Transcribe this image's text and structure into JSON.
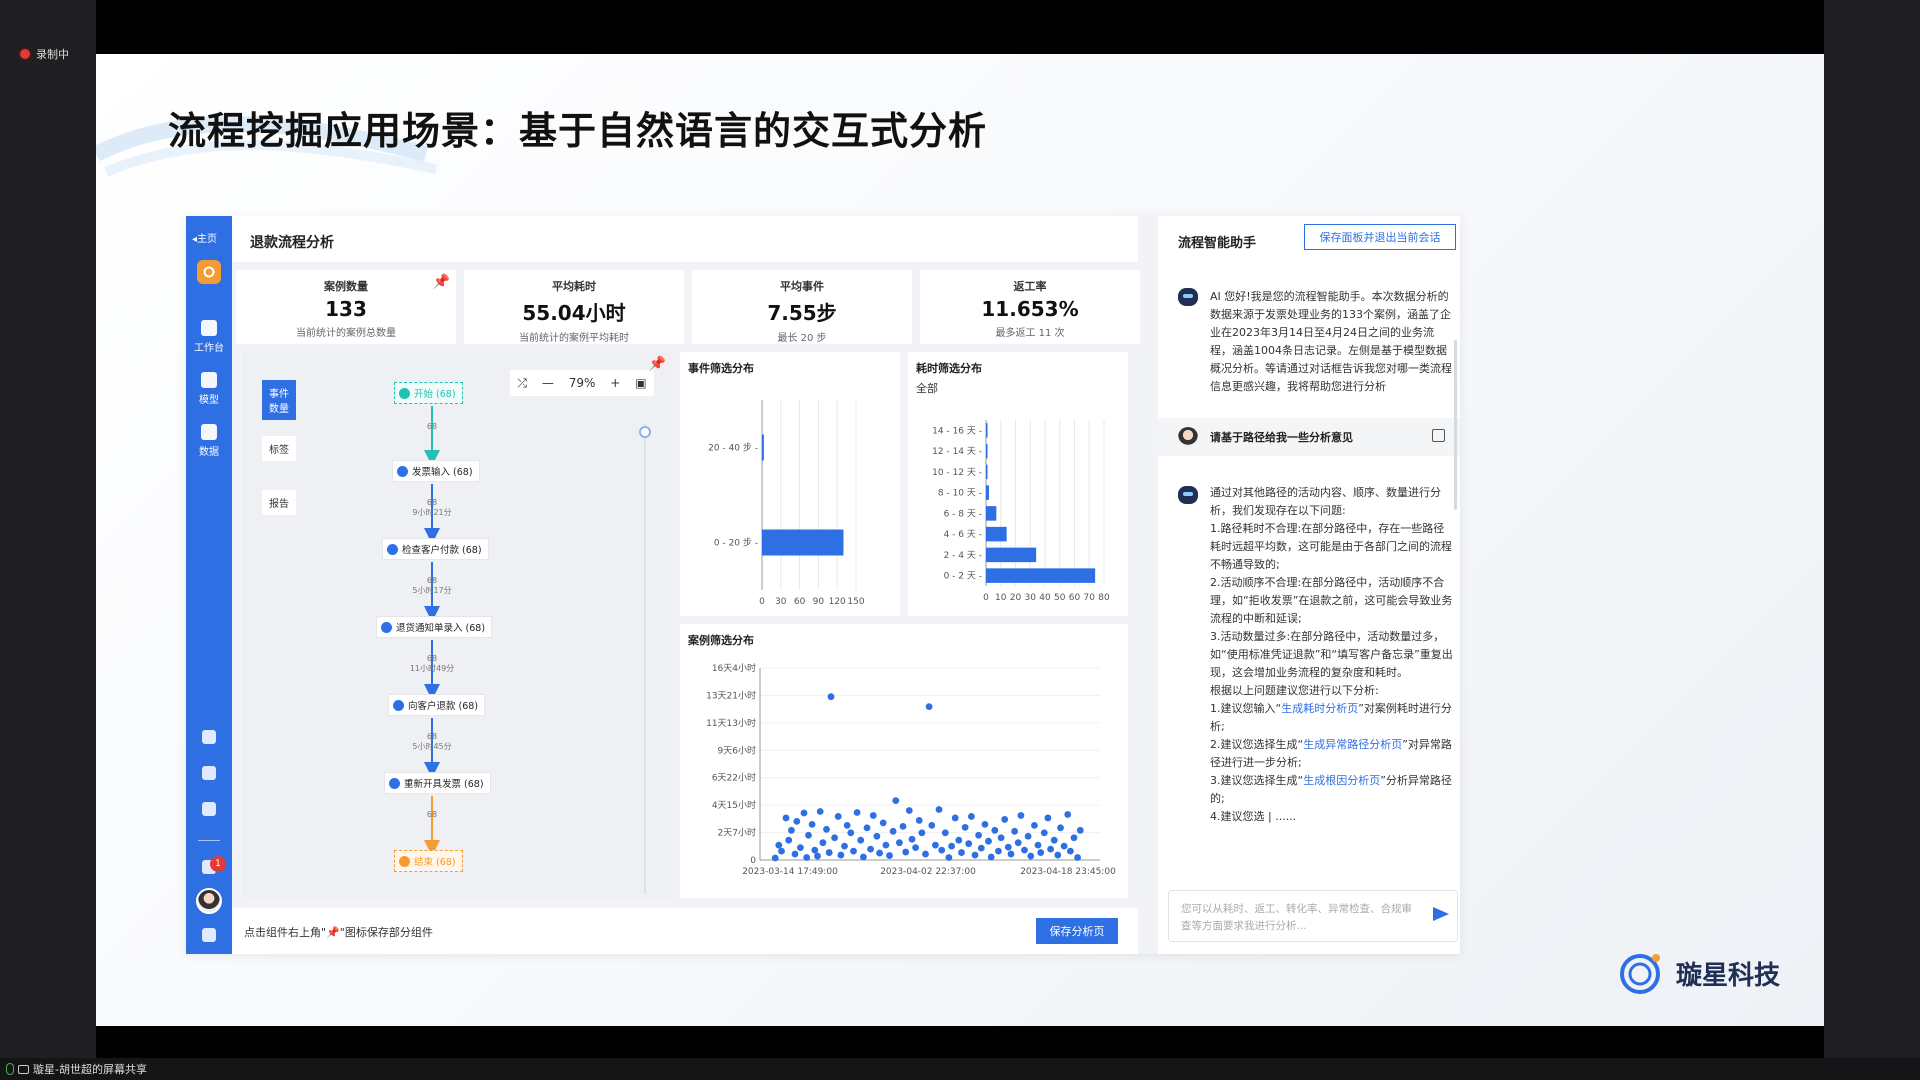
{
  "meeting": {
    "recording_label": "录制中",
    "share_label": "璇星-胡世超的屏幕共享"
  },
  "slide": {
    "title": "流程挖掘应用场景：基于自然语言的交互式分析",
    "brand": "璇星科技"
  },
  "app": {
    "nav": {
      "home": "◂主页",
      "items": [
        "工作台",
        "模型",
        "数据"
      ],
      "notification_count": "1"
    },
    "page_title": "退款流程分析",
    "kpis": [
      {
        "title": "案例数量",
        "value": "133",
        "sub": "当前统计的案例总数量"
      },
      {
        "title": "平均耗时",
        "value": "55.04小时",
        "sub": "当前统计的案例平均耗时"
      },
      {
        "title": "平均事件",
        "value": "7.55步",
        "sub": "最长 20 步"
      },
      {
        "title": "返工率",
        "value": "11.653%",
        "sub": "最多返工 11 次"
      }
    ],
    "process": {
      "tabs": [
        "事件\n数量",
        "标签",
        "报告"
      ],
      "zoom": "79%",
      "nodes": [
        "开始 (68)",
        "发票输入 (68)",
        "检查客户付款 (68)",
        "退货通知单录入 (68)",
        "向客户退款 (68)",
        "重新开具发票 (68)",
        "结束 (68)"
      ],
      "edges": [
        {
          "count": "68",
          "duration": ""
        },
        {
          "count": "68",
          "duration": "9小时21分"
        },
        {
          "count": "68",
          "duration": "5小时17分"
        },
        {
          "count": "68",
          "duration": "11小时49分"
        },
        {
          "count": "68",
          "duration": "5小时45分"
        },
        {
          "count": "68",
          "duration": ""
        }
      ]
    },
    "footer": {
      "hint": "点击组件右上角\"📌\"图标保存部分组件",
      "save_label": "保存分析页"
    }
  },
  "chart_data": [
    {
      "type": "bar",
      "orientation": "horizontal",
      "title": "事件筛选分布",
      "categories": [
        "0 - 20 步",
        "20 - 40 步"
      ],
      "values": [
        130,
        3
      ],
      "xticks": [
        "0",
        "30",
        "60",
        "90",
        "120",
        "150"
      ],
      "xlim": [
        0,
        150
      ],
      "color": "#2f6fe4"
    },
    {
      "type": "bar",
      "orientation": "horizontal",
      "title": "耗时筛选分布",
      "subtitle": "全部",
      "categories": [
        "0 - 2 天",
        "2 - 4 天",
        "4 - 6 天",
        "6 - 8 天",
        "8 - 10 天",
        "10 - 12 天",
        "12 - 14 天",
        "14 - 16 天"
      ],
      "values": [
        74,
        34,
        14,
        7,
        2,
        1,
        1,
        1
      ],
      "xticks": [
        "0",
        "10",
        "20",
        "30",
        "40",
        "50",
        "60",
        "70",
        "80"
      ],
      "xlim": [
        0,
        80
      ],
      "color": "#2f6fe4"
    },
    {
      "type": "scatter",
      "title": "案例筛选分布",
      "yticks": [
        "16天4小时",
        "13天21小时",
        "11天13小时",
        "9天6小时",
        "6天22小时",
        "4天15小时",
        "2天7小时",
        "0"
      ],
      "ylim_hours": [
        0,
        388
      ],
      "xticks": [
        "2023-03-14 17:49:00",
        "2023-04-02 22:37:00",
        "2023-04-18 23:45:00"
      ],
      "x_unit": "days since 2023-03-14",
      "xlim": [
        0,
        36
      ],
      "color": "#2f6fe4",
      "points": [
        [
          0.8,
          4
        ],
        [
          1.2,
          30
        ],
        [
          1.5,
          18
        ],
        [
          2.0,
          85
        ],
        [
          2.3,
          40
        ],
        [
          2.6,
          60
        ],
        [
          3.0,
          12
        ],
        [
          3.2,
          78
        ],
        [
          3.6,
          25
        ],
        [
          4.0,
          95
        ],
        [
          4.3,
          5
        ],
        [
          4.5,
          50
        ],
        [
          4.9,
          72
        ],
        [
          5.2,
          20
        ],
        [
          5.5,
          8
        ],
        [
          5.8,
          98
        ],
        [
          6.1,
          35
        ],
        [
          6.5,
          62
        ],
        [
          6.8,
          15
        ],
        [
          7.0,
          330
        ],
        [
          7.4,
          45
        ],
        [
          7.8,
          88
        ],
        [
          8.1,
          10
        ],
        [
          8.5,
          28
        ],
        [
          8.8,
          70
        ],
        [
          9.2,
          55
        ],
        [
          9.5,
          18
        ],
        [
          9.9,
          96
        ],
        [
          10.3,
          40
        ],
        [
          10.6,
          6
        ],
        [
          11.0,
          65
        ],
        [
          11.4,
          22
        ],
        [
          11.7,
          90
        ],
        [
          12.1,
          48
        ],
        [
          12.4,
          14
        ],
        [
          12.8,
          75
        ],
        [
          13.1,
          30
        ],
        [
          13.5,
          9
        ],
        [
          13.9,
          58
        ],
        [
          14.2,
          120
        ],
        [
          14.6,
          35
        ],
        [
          15.0,
          68
        ],
        [
          15.3,
          16
        ],
        [
          15.7,
          100
        ],
        [
          16.0,
          42
        ],
        [
          16.4,
          25
        ],
        [
          16.8,
          80
        ],
        [
          17.1,
          55
        ],
        [
          17.5,
          12
        ],
        [
          17.9,
          310
        ],
        [
          18.2,
          70
        ],
        [
          18.6,
          30
        ],
        [
          19.0,
          102
        ],
        [
          19.3,
          20
        ],
        [
          19.7,
          55
        ],
        [
          20.1,
          5
        ],
        [
          20.4,
          28
        ],
        [
          20.8,
          85
        ],
        [
          21.2,
          40
        ],
        [
          21.5,
          15
        ],
        [
          21.9,
          66
        ],
        [
          22.3,
          33
        ],
        [
          22.6,
          88
        ],
        [
          23.0,
          10
        ],
        [
          23.4,
          50
        ],
        [
          23.7,
          24
        ],
        [
          24.1,
          72
        ],
        [
          24.5,
          38
        ],
        [
          24.8,
          6
        ],
        [
          25.2,
          60
        ],
        [
          25.6,
          18
        ],
        [
          25.9,
          45
        ],
        [
          26.3,
          82
        ],
        [
          26.7,
          26
        ],
        [
          27.0,
          12
        ],
        [
          27.4,
          58
        ],
        [
          27.8,
          35
        ],
        [
          28.1,
          90
        ],
        [
          28.5,
          20
        ],
        [
          28.9,
          48
        ],
        [
          29.2,
          8
        ],
        [
          29.6,
          70
        ],
        [
          30.0,
          30
        ],
        [
          30.3,
          15
        ],
        [
          30.7,
          55
        ],
        [
          31.1,
          85
        ],
        [
          31.4,
          22
        ],
        [
          31.8,
          40
        ],
        [
          32.2,
          10
        ],
        [
          32.5,
          65
        ],
        [
          32.9,
          28
        ],
        [
          33.3,
          92
        ],
        [
          33.6,
          18
        ],
        [
          34.0,
          45
        ],
        [
          34.4,
          5
        ],
        [
          34.7,
          60
        ]
      ]
    }
  ],
  "assistant": {
    "title": "流程智能助手",
    "save_exit": "保存面板并退出当前会话",
    "greeting": "AI 您好!我是您的流程智能助手。本次数据分析的数据来源于发票处理业务的133个案例，涵盖了企业在2023年3月14日至4月24日之间的业务流程，涵盖1004条日志记录。左侧是基于模型数据概况分析。等请通过对话框告诉我您对哪一类流程信息更感兴趣，我将帮助您进行分析",
    "user_msg": "请基于路径给我一些分析意见",
    "reply": {
      "intro": "通过对其他路径的活动内容、顺序、数量进行分析，我们发现存在以下问题:",
      "p1": "1.路径耗时不合理:在部分路径中，存在一些路径耗时远超平均数，这可能是由于各部门之间的流程不畅通导致的;",
      "p2": "2.活动顺序不合理:在部分路径中，活动顺序不合理，如“拒收发票”在退款之前，这可能会导致业务流程的中断和延误;",
      "p3": "3.活动数量过多:在部分路径中，活动数量过多，如“使用标准凭证退款”和“填写客户备忘录”重复出现，这会增加业务流程的复杂度和耗时。",
      "lead": "根据以上问题建议您进行以下分析:",
      "s1_pre": "1.建议您输入“",
      "s1_link": "生成耗时分析页",
      "s1_post": "”对案例耗时进行分析;",
      "s2_pre": "2.建议您选择生成“",
      "s2_link": "生成异常路径分析页",
      "s2_post": "”对异常路径进行进一步分析;",
      "s3_pre": "3.建议您选择生成“",
      "s3_link": "生成根因分析页",
      "s3_post": "”分析异常路径的;",
      "s4": "4.建议您选 | ......"
    },
    "input_placeholder": "您可以从耗时、返工、转化率、异常检查、合规审查等方面要求我进行分析..."
  }
}
